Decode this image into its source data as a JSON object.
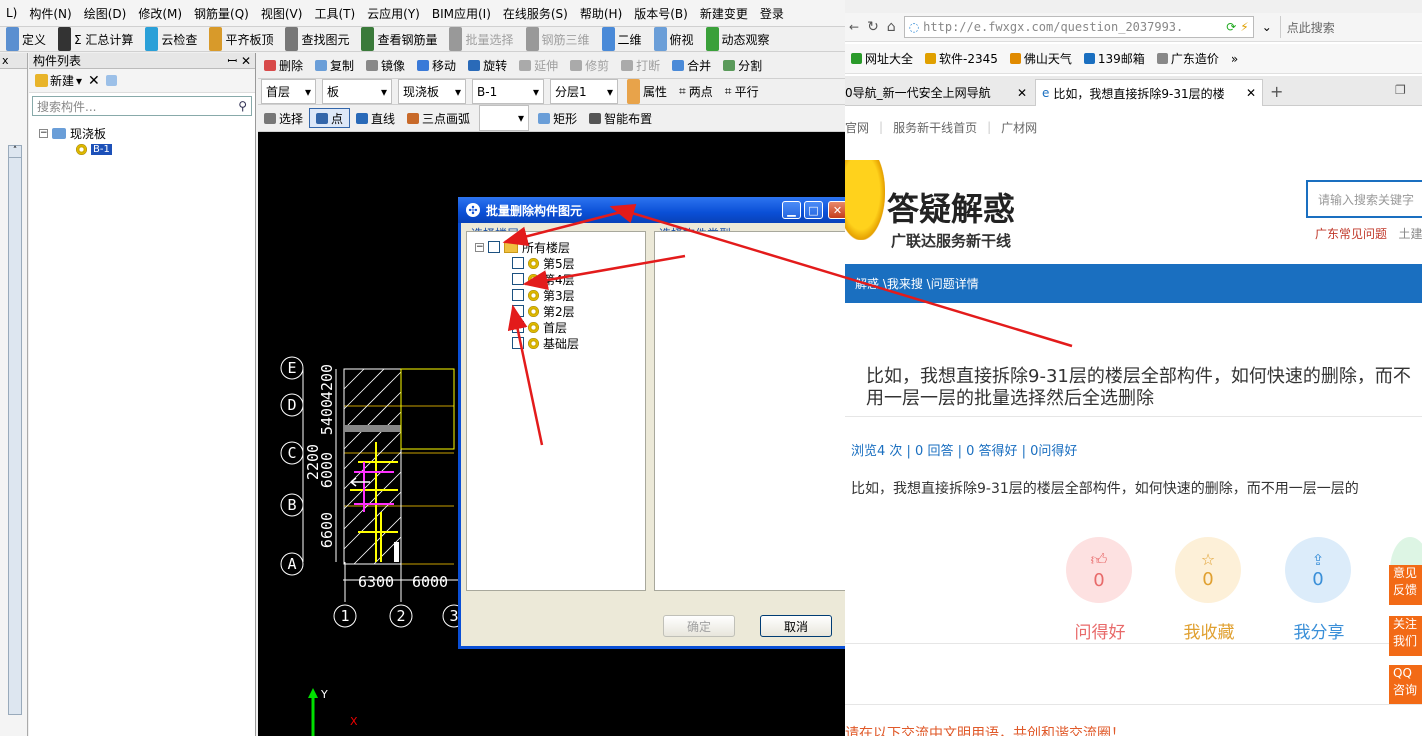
{
  "app": {
    "menu": [
      "L)",
      "构件(N)",
      "绘图(D)",
      "修改(M)",
      "钢筋量(Q)",
      "视图(V)",
      "工具(T)",
      "云应用(Y)",
      "BIM应用(I)",
      "在线服务(S)",
      "帮助(H)",
      "版本号(B)",
      "新建变更",
      "登录"
    ],
    "toolbar1": [
      "定义",
      "Σ 汇总计算",
      "云检查",
      "平齐板顶",
      "查找图元",
      "查看钢筋量",
      "批量选择",
      "钢筋三维",
      "二维",
      "俯视",
      "动态观察"
    ],
    "toolbar2": [
      "删除",
      "复制",
      "镜像",
      "移动",
      "旋转",
      "延伸",
      "修剪",
      "打断",
      "合并",
      "分割"
    ],
    "toolbar3": {
      "floor": "首层",
      "type": "板",
      "subtype": "现浇板",
      "component": "B-1",
      "layer": "分层1",
      "props": "属性",
      "two_point": "两点",
      "parallel": "平行"
    },
    "toolbar4": [
      "选择",
      "点",
      "直线",
      "三点画弧",
      "矩形",
      "智能布置"
    ],
    "component_list": {
      "title": "构件列表",
      "new_label": "新建",
      "search_placeholder": "搜索构件...",
      "tree_root": "现浇板",
      "tree_child": "B-1"
    },
    "canvas": {
      "axis_letters": [
        "E",
        "D",
        "C",
        "B",
        "A"
      ],
      "axis_numbers": [
        "1",
        "2",
        "3"
      ],
      "dim_vertical": [
        "6600",
        "2200",
        "6000",
        "5400",
        "4200"
      ],
      "dim_horizontal": [
        "6300",
        "6000"
      ],
      "axis_y": "Y",
      "axis_x": "X"
    },
    "dialog": {
      "title": "批量删除构件图元",
      "left_label": "选择楼层",
      "right_label": "选择构件类型",
      "tree_root": "所有楼层",
      "floors": [
        "第5层",
        "第4层",
        "第3层",
        "第2层",
        "首层",
        "基础层"
      ],
      "ok": "确定",
      "cancel": "取消"
    }
  },
  "browser": {
    "url": "http://e.fwxgx.com/question_2037993.",
    "search_placeholder": "点此搜索",
    "bookmarks": [
      "网址大全",
      "软件-2345",
      "佛山天气",
      "139邮箱",
      "广东造价"
    ],
    "tabs": [
      {
        "label": "0导航_新一代安全上网导航"
      },
      {
        "label": "比如，我想直接拆除9-31层的楼"
      }
    ],
    "topnav": [
      "官网",
      "服务新干线首页",
      "广材网"
    ],
    "logo_title": "答疑解惑",
    "logo_subtitle": "广联达服务新干线",
    "site_search_placeholder": "请输入搜索关键字",
    "hot_links": [
      "广东常见问题",
      "土建"
    ],
    "breadcrumb": "解惑 \\我来搜 \\问题详情",
    "question_title": "比如，我想直接拆除9-31层的楼层全部构件，如何快速的删除，而不用一层一层的批量选择然后全选删除",
    "stats": "浏览4 次 | 0 回答 | 0 答得好 | 0问得好",
    "question_body": "比如，我想直接拆除9-31层的楼层全部构件，如何快速的删除，而不用一层一层的",
    "actions": [
      {
        "count": "0",
        "label": "问得好"
      },
      {
        "count": "0",
        "label": "我收藏"
      },
      {
        "count": "0",
        "label": "我分享"
      }
    ],
    "side_buttons": [
      "意见反馈",
      "关注我们",
      "QQ咨询"
    ],
    "footer_text": "请在以下交流中文明用语，共创和谐交流圈！"
  },
  "colors": {
    "annotation_arrow": "#e31b1b",
    "titlebar": "#0a4fd6",
    "browser_blue": "#1a6fc0",
    "accent_orange": "#f26a16"
  }
}
